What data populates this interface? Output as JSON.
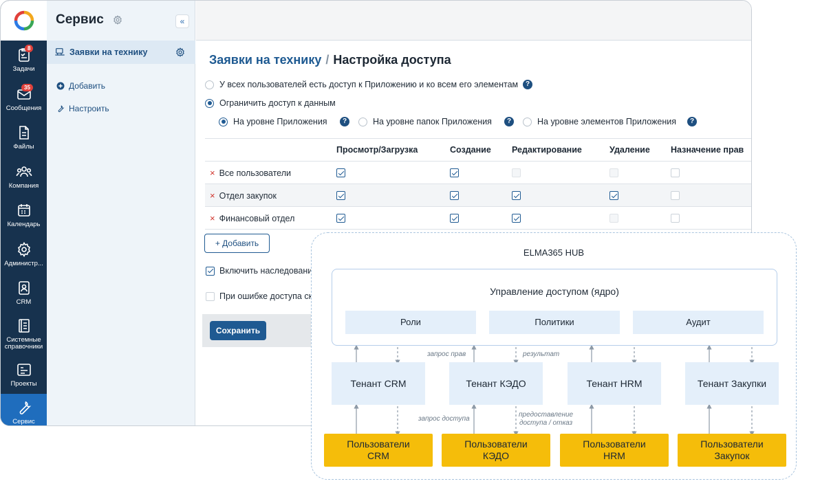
{
  "nav": {
    "items": [
      {
        "label": "Задачи",
        "icon": "tasks-icon",
        "badge": "8"
      },
      {
        "label": "Сообщения",
        "icon": "messages-icon",
        "badge": "35"
      },
      {
        "label": "Файлы",
        "icon": "files-icon"
      },
      {
        "label": "Компания",
        "icon": "company-icon"
      },
      {
        "label": "Календарь",
        "icon": "calendar-icon"
      },
      {
        "label": "Администр...",
        "icon": "admin-gear-icon"
      },
      {
        "label": "CRM",
        "icon": "crm-icon"
      },
      {
        "label": "Системные справочники",
        "icon": "directories-icon"
      },
      {
        "label": "Проекты",
        "icon": "projects-icon"
      },
      {
        "label": "Сервис",
        "icon": "service-wrench-icon",
        "active": true
      }
    ]
  },
  "side": {
    "title": "Сервис",
    "collapse": "«",
    "app_item": "Заявки на технику",
    "links": {
      "add": "Добавить",
      "configure": "Настроить"
    }
  },
  "main": {
    "breadcrumb": {
      "parent": "Заявки на технику",
      "separator": "/",
      "current": "Настройка доступа"
    },
    "access_mode": {
      "all_access": "У всех пользователей есть доступ к Приложению и ко всем его элементам",
      "restricted": "Ограничить доступ к данным",
      "selected": "restricted"
    },
    "levels": {
      "app": "На уровне Приложения",
      "folders": "На уровне папок Приложения",
      "elements": "На уровне элементов Приложения",
      "selected": "app"
    },
    "help": "?",
    "table": {
      "columns": [
        "Просмотр/Загрузка",
        "Создание",
        "Редактирование",
        "Удаление",
        "Назначение прав"
      ],
      "rows": [
        {
          "name": "Все пользователи",
          "remove": "×",
          "perms": [
            "on",
            "on",
            "disabled",
            "disabled",
            "off"
          ]
        },
        {
          "name": "Отдел закупок",
          "remove": "×",
          "perms": [
            "on",
            "on",
            "on",
            "on",
            "off"
          ]
        },
        {
          "name": "Финансовый отдел",
          "remove": "×",
          "perms": [
            "on",
            "on",
            "on",
            "disabled",
            "off"
          ]
        }
      ]
    },
    "add_button": "+ Добавить",
    "inherit": {
      "label": "Включить наследование",
      "checked": true
    },
    "on_error": {
      "label": "При ошибке доступа скр",
      "checked": false
    },
    "save_button": "Сохранить"
  },
  "hub": {
    "title": "ELMA365 HUB",
    "core": {
      "title": "Управление доступом (ядро)",
      "roles": "Роли",
      "policies": "Политики",
      "audit": "Аудит"
    },
    "tenants": [
      "Тенант CRM",
      "Тенант КЭДО",
      "Тенант HRM",
      "Тенант Закупки"
    ],
    "user_groups": [
      {
        "line1": "Пользователи",
        "line2": "CRM"
      },
      {
        "line1": "Пользователи",
        "line2": "КЭДО"
      },
      {
        "line1": "Пользователи",
        "line2": "HRM"
      },
      {
        "line1": "Пользователи",
        "line2": "Закупок"
      }
    ],
    "annotations": {
      "rights_request": "запрос прав",
      "result": "результат",
      "access_request": "запрос доступа",
      "grant_line1": "предоставление",
      "grant_line2": "доступа / отказ"
    }
  }
}
